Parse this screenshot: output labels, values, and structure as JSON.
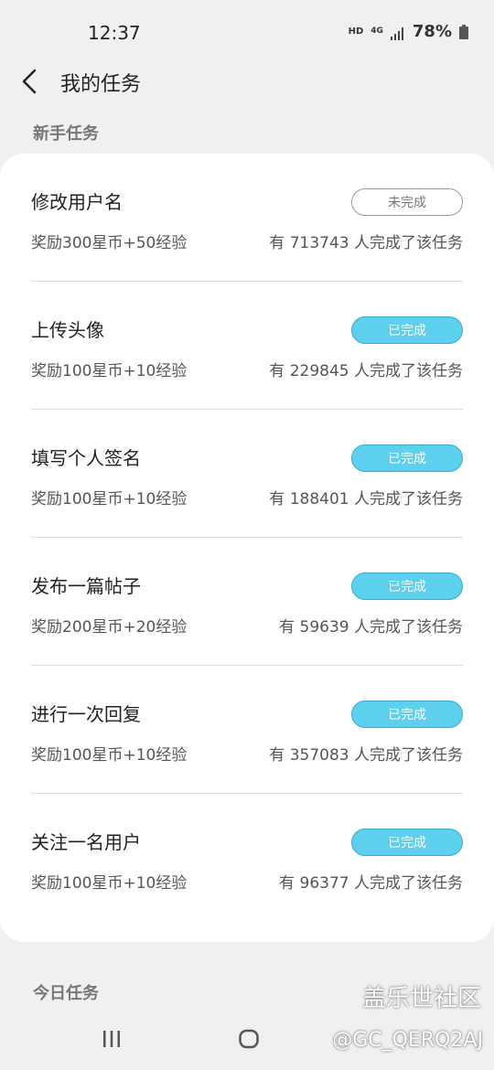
{
  "status_bar": {
    "time": "12:37",
    "hd": "HD",
    "network": "4G",
    "battery": "78%"
  },
  "header": {
    "title": "我的任务",
    "back_icon": "chevron-left-icon"
  },
  "sections": {
    "newbie_title": "新手任务",
    "daily_title": "今日任务"
  },
  "tasks": [
    {
      "name": "修改用户名",
      "reward": "奖励300星币+50经验",
      "count": "有 713743 人完成了该任务",
      "status": "未完成",
      "done": false
    },
    {
      "name": "上传头像",
      "reward": "奖励100星币+10经验",
      "count": "有 229845 人完成了该任务",
      "status": "已完成",
      "done": true
    },
    {
      "name": "填写个人签名",
      "reward": "奖励100星币+10经验",
      "count": "有 188401 人完成了该任务",
      "status": "已完成",
      "done": true
    },
    {
      "name": "发布一篇帖子",
      "reward": "奖励200星币+20经验",
      "count": "有 59639 人完成了该任务",
      "status": "已完成",
      "done": true
    },
    {
      "name": "进行一次回复",
      "reward": "奖励100星币+10经验",
      "count": "有 357083 人完成了该任务",
      "status": "已完成",
      "done": true
    },
    {
      "name": "关注一名用户",
      "reward": "奖励100星币+10经验",
      "count": "有 96377 人完成了该任务",
      "status": "已完成",
      "done": true
    }
  ],
  "colors": {
    "done_fill": "#5dd0ee",
    "done_border": "#3ba9cf",
    "pending_border": "#9a9a9a",
    "background": "#f0f0f0",
    "card": "#ffffff"
  },
  "watermark": {
    "logo": "盖乐世社区",
    "user": "@GC_QERQ2AJ"
  }
}
